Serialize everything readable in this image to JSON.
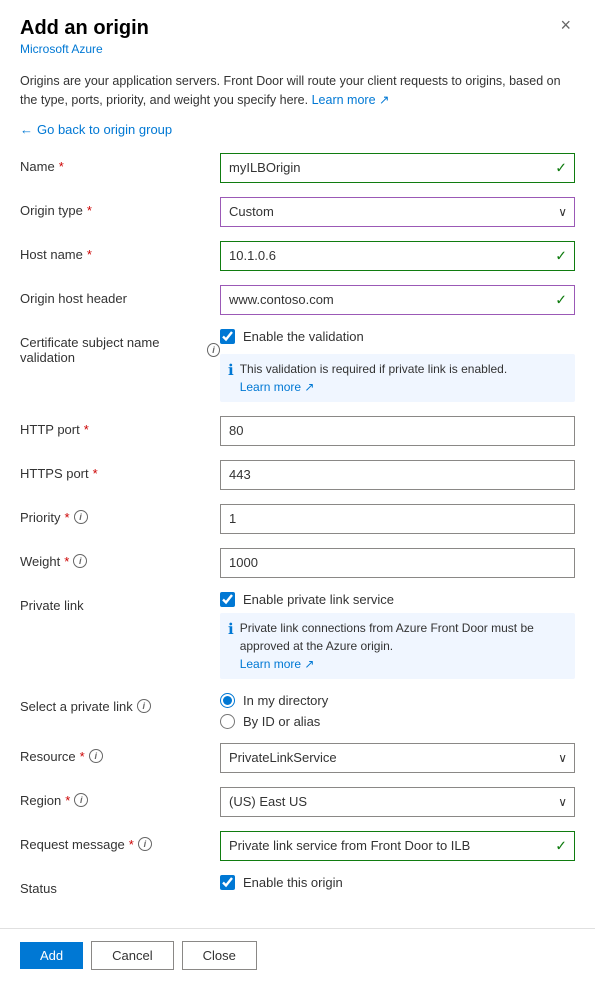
{
  "dialog": {
    "title": "Add an origin",
    "subtitle": "Microsoft Azure",
    "close_label": "×"
  },
  "info": {
    "description": "Origins are your application servers. Front Door will route your client requests to origins, based on the type, ports, priority, and weight you specify here.",
    "learn_more": "Learn more",
    "back_link": "Go back to origin group"
  },
  "form": {
    "name_label": "Name",
    "name_value": "myILBOrigin",
    "origin_type_label": "Origin type",
    "origin_type_value": "Custom",
    "host_name_label": "Host name",
    "host_name_value": "10.1.0.6",
    "origin_host_header_label": "Origin host header",
    "origin_host_header_value": "www.contoso.com",
    "cert_subject_label": "Certificate subject name validation",
    "cert_checkbox_label": "Enable the validation",
    "cert_info": "This validation is required if private link is enabled.",
    "cert_learn_more": "Learn more",
    "http_port_label": "HTTP port",
    "http_port_value": "80",
    "https_port_label": "HTTPS port",
    "https_port_value": "443",
    "priority_label": "Priority",
    "priority_value": "1",
    "weight_label": "Weight",
    "weight_value": "1000",
    "private_link_label": "Private link",
    "private_link_checkbox_label": "Enable private link service",
    "private_link_info": "Private link connections from Azure Front Door must be approved at the Azure origin.",
    "private_link_learn_more": "Learn more",
    "select_private_link_label": "Select a private link",
    "radio_in_directory": "In my directory",
    "radio_by_id": "By ID or alias",
    "resource_label": "Resource",
    "resource_value": "PrivateLinkService",
    "region_label": "Region",
    "region_value": "(US) East US",
    "request_message_label": "Request message",
    "request_message_value": "Private link service from Front Door to ILB",
    "status_label": "Status",
    "status_checkbox_label": "Enable this origin"
  },
  "footer": {
    "add_label": "Add",
    "cancel_label": "Cancel",
    "close_label": "Close"
  }
}
